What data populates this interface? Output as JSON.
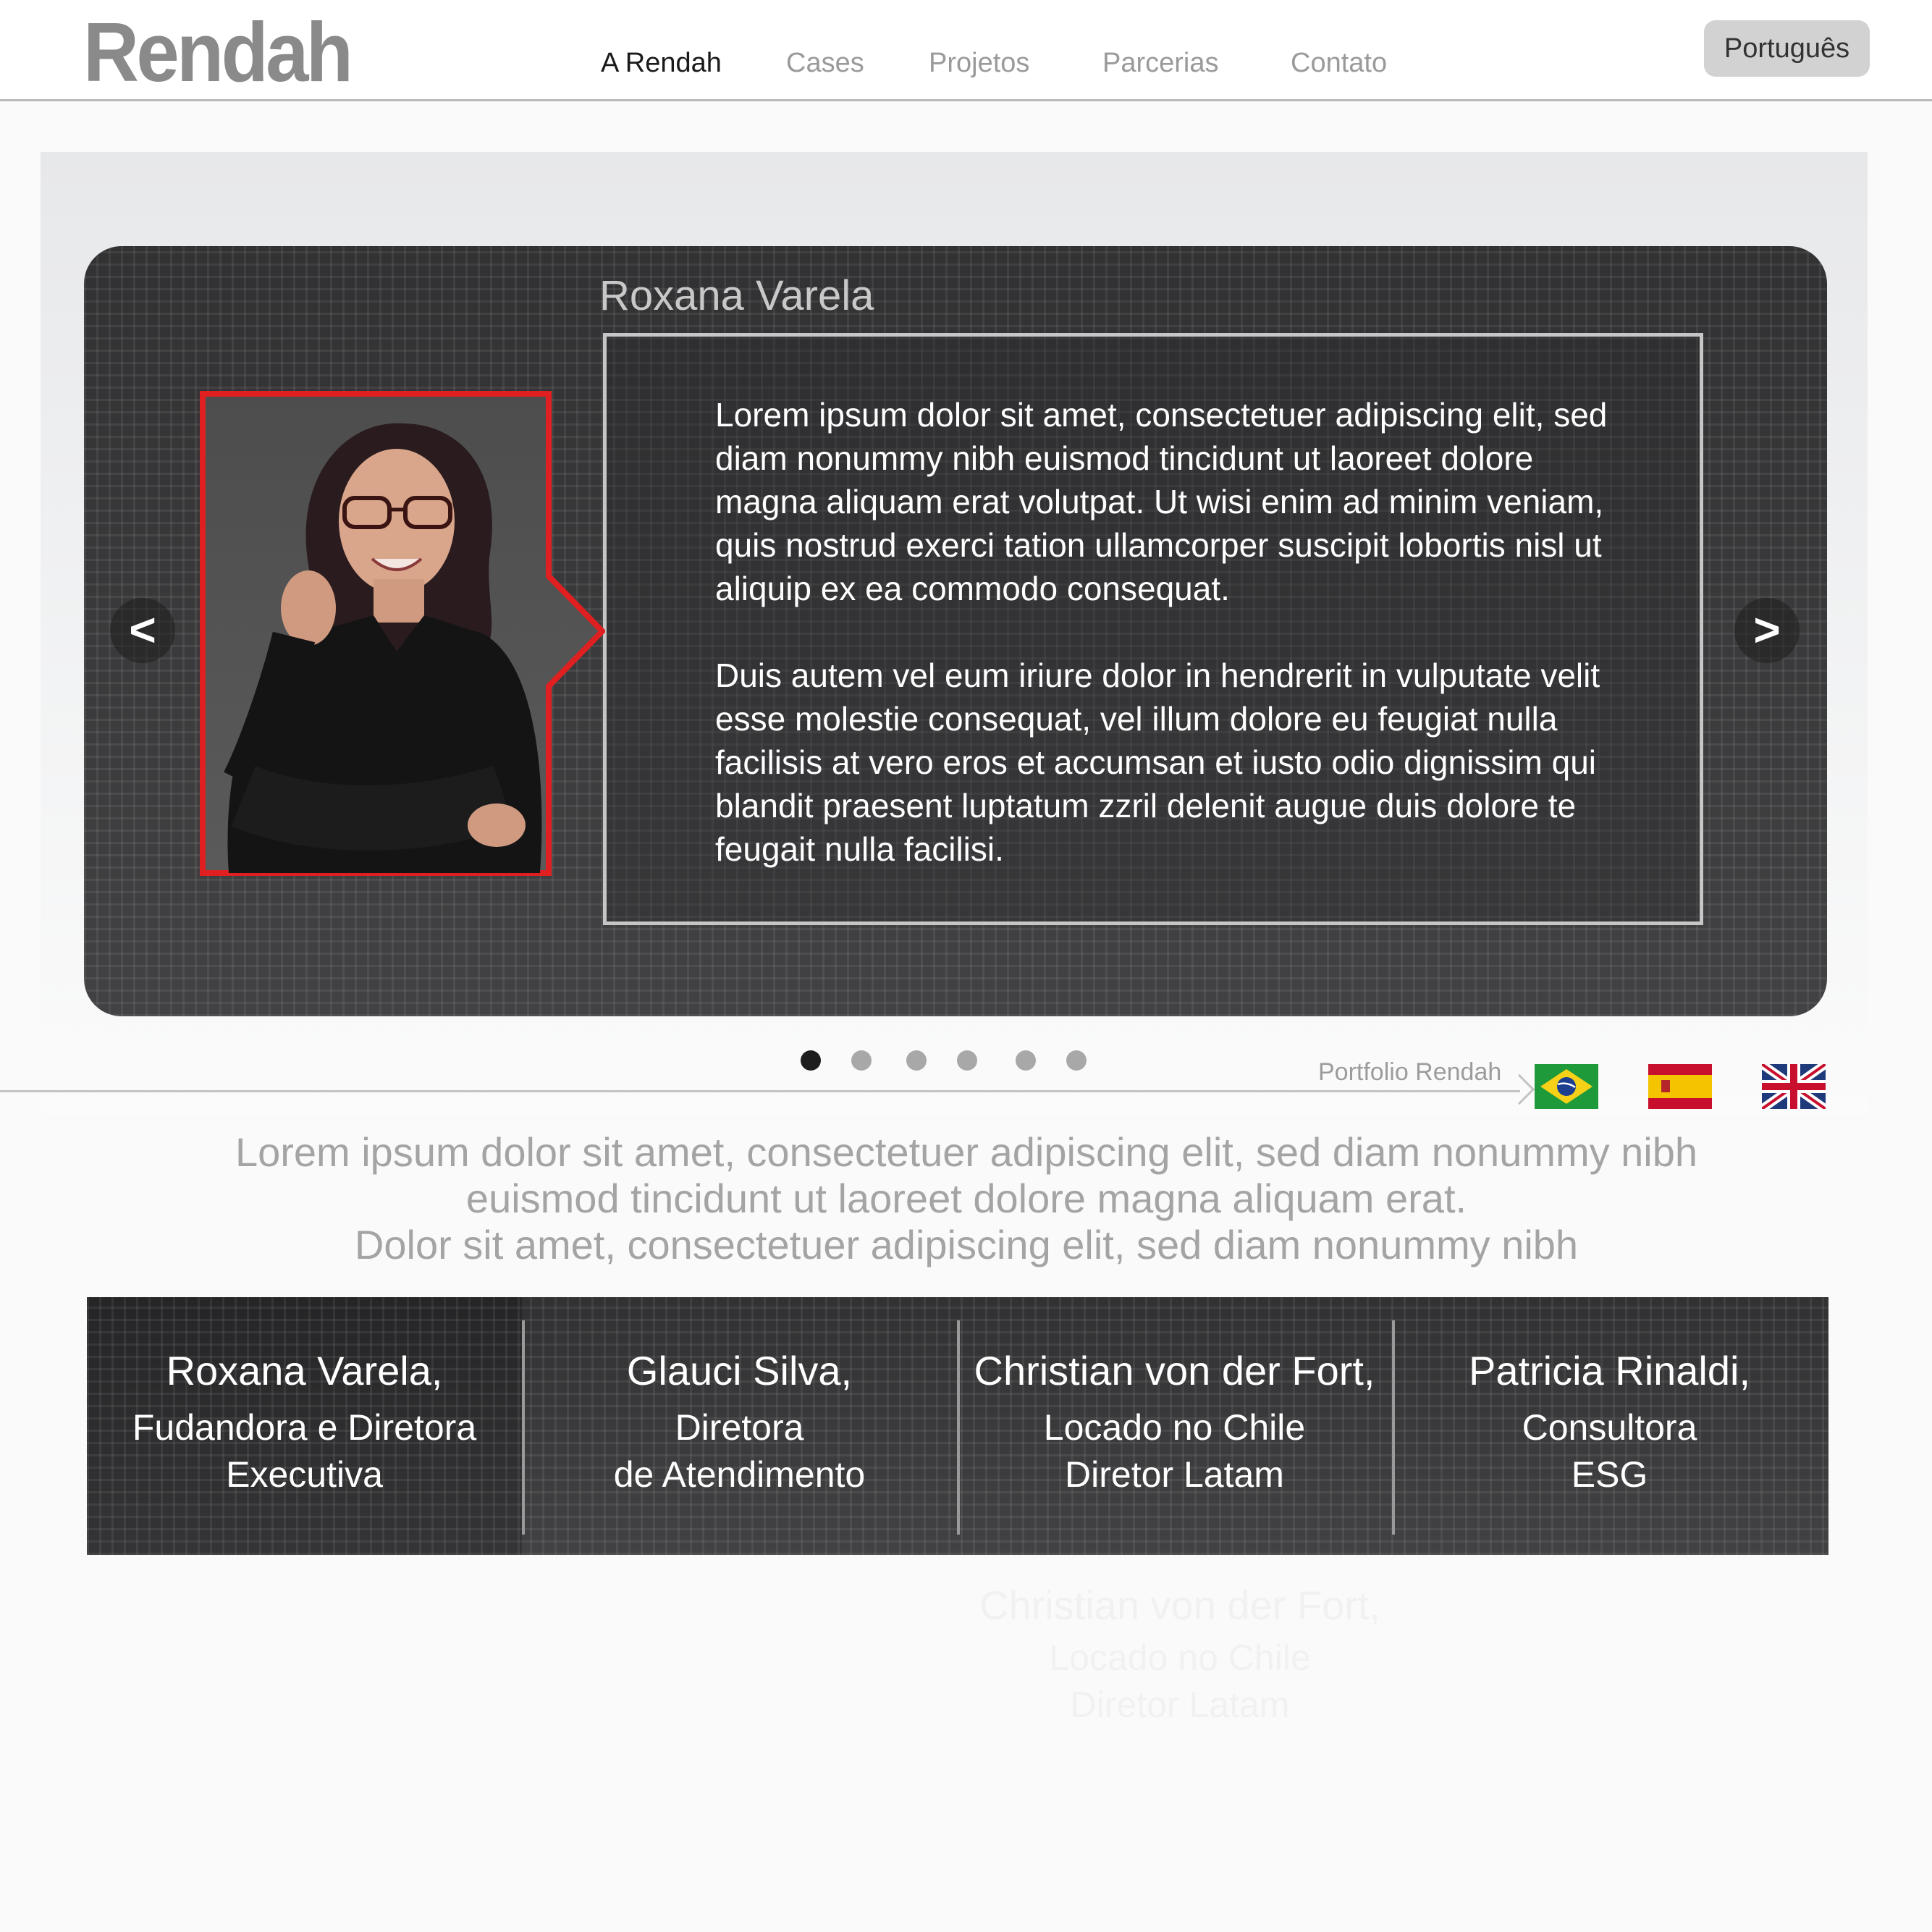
{
  "header": {
    "logo": "Rendah",
    "nav": [
      {
        "label": "A Rendah",
        "active": true
      },
      {
        "label": "Cases",
        "active": false
      },
      {
        "label": "Projetos",
        "active": false
      },
      {
        "label": "Parcerias",
        "active": false
      },
      {
        "label": "Contato",
        "active": false
      }
    ],
    "language_button": "Português"
  },
  "slider": {
    "name": "Roxana Varela",
    "paragraph_1": "Lorem ipsum dolor sit amet, consectetuer adipiscing elit, sed diam nonummy nibh euismod tincidunt ut laoreet dolore magna aliquam erat volutpat. Ut wisi enim ad minim veniam, quis nostrud exerci tation ullamcorper suscipit lobortis nisl ut aliquip ex ea commodo consequat.",
    "paragraph_2": "Duis autem vel eum iriure dolor in hendrerit in vulputate velit esse molestie consequat, vel illum dolore eu feugiat nulla facilisis at vero eros et accumsan et iusto odio dignissim qui blandit praesent luptatum zzril delenit augue duis dolore te feugait nulla facilisi.",
    "prev_label": "<",
    "next_label": ">",
    "dots_total": 6,
    "active_dot": 1
  },
  "portfolio": {
    "label": "Portfolio Rendah",
    "flags": [
      "brazil-flag",
      "spain-flag",
      "uk-flag"
    ]
  },
  "intro": {
    "line_1": "Lorem ipsum dolor sit amet, consectetuer adipiscing elit, sed diam nonummy nibh",
    "line_2": "euismod tincidunt ut laoreet dolore magna aliquam erat.",
    "line_3": "Dolor sit amet, consectetuer adipiscing elit, sed diam nonummy nibh"
  },
  "team": [
    {
      "name": "Roxana Varela,",
      "role_1": "Fudandora e Diretora",
      "role_2": "Executiva"
    },
    {
      "name": "Glauci Silva,",
      "role_1": "Diretora",
      "role_2": "de Atendimento"
    },
    {
      "name": "Christian von der Fort,",
      "role_1": "Locado no Chile",
      "role_2": "Diretor Latam"
    },
    {
      "name": "Patricia Rinaldi,",
      "role_1": "Consultora",
      "role_2": "ESG"
    }
  ],
  "ghost_card": {
    "name": "Christian von der Fort,",
    "role_1": "Locado no Chile",
    "role_2": "Diretor Latam"
  },
  "colors": {
    "accent_red": "#e02020",
    "panel_dark": "#3a3a3c",
    "nav_active": "#1a1a1a",
    "nav_inactive": "#9a9a9a"
  }
}
